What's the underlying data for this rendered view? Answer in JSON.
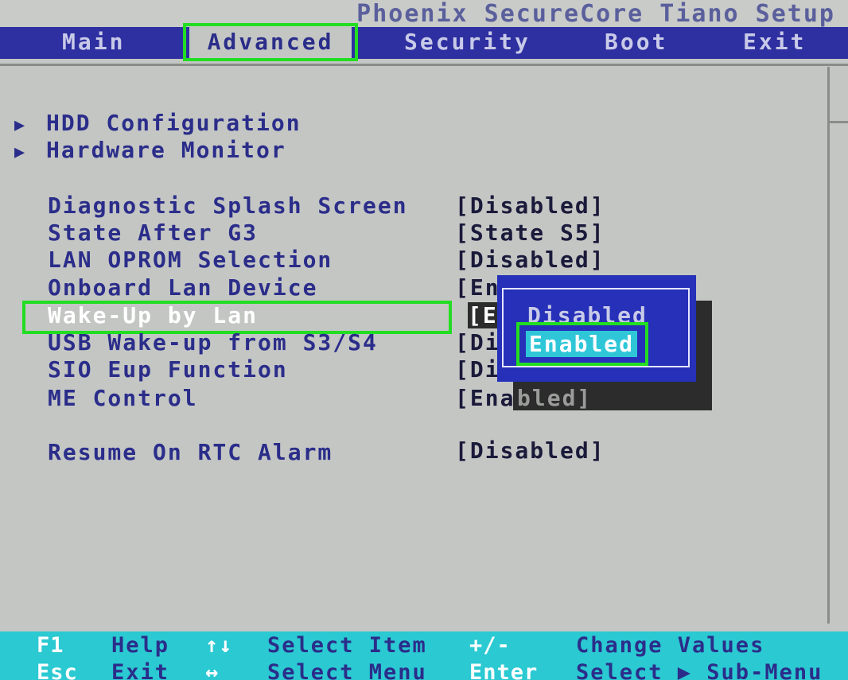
{
  "title": "Phoenix SecureCore Tiano Setup",
  "menu": [
    {
      "label": "Main"
    },
    {
      "label": "Advanced"
    },
    {
      "label": "Security"
    },
    {
      "label": "Boot"
    },
    {
      "label": "Exit"
    }
  ],
  "submenus": [
    {
      "arrow": "▶",
      "label": "HDD Configuration"
    },
    {
      "arrow": "▶",
      "label": "Hardware Monitor"
    }
  ],
  "settings": [
    {
      "label": "Diagnostic Splash Screen",
      "value": "[Disabled]"
    },
    {
      "label": "State After G3",
      "value": "[State S5]"
    },
    {
      "label": "LAN OPROM Selection",
      "value": "[Disabled]"
    },
    {
      "label": "Onboard Lan Device",
      "value": "[En"
    },
    {
      "label": "Wake-Up by Lan",
      "value": "[En"
    },
    {
      "label": "USB Wake-up from S3/S4",
      "value": "[Di"
    },
    {
      "label": "SIO Eup Function",
      "value": "[Di"
    },
    {
      "label": "ME Control",
      "value": "[Ena",
      "value_shadowed": "bled]"
    },
    {
      "label": "Resume On RTC Alarm",
      "value": "[Disabled]"
    }
  ],
  "popup": {
    "options": [
      "Disabled",
      "Enabled"
    ],
    "selected": "Enabled"
  },
  "footer": {
    "row1": [
      {
        "key": "F1",
        "desc": "Help"
      },
      {
        "key": "↑↓",
        "desc": "Select Item"
      },
      {
        "key": "+/-",
        "desc": "Change Values"
      }
    ],
    "row2": [
      {
        "key": "Esc",
        "desc": "Exit"
      },
      {
        "key": "↔",
        "desc": "Select Menu"
      },
      {
        "key": "Enter",
        "desc": "Select ▶ Sub-Menu"
      }
    ]
  },
  "colors": {
    "menubar": "#2e2fa0",
    "text": "#2b2d8a",
    "popup": "#2630b8",
    "selection": "#2fc7d8",
    "highlight_frame": "#22dd22",
    "footer": "#2bc9d2"
  }
}
